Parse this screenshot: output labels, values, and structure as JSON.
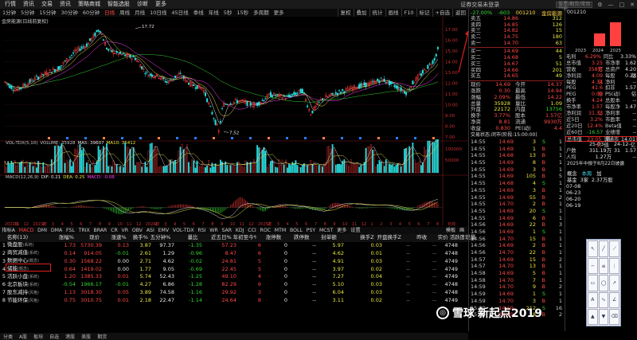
{
  "menu": {
    "items": [
      "行情",
      "资讯",
      "交易",
      "资讯",
      "策略商城",
      "智能选股",
      "诊断",
      "更多"
    ],
    "title": "证券交易未登录",
    "search_placeholder": "股票/期货/常用功能"
  },
  "timeframes": {
    "items": [
      "1分钟",
      "5分钟",
      "15分钟",
      "30分钟",
      "60分钟",
      "日线",
      "周线",
      "月线",
      "10日线",
      "45日线",
      "季线",
      "年线",
      "5秒",
      "15秒",
      "多周期",
      "更多"
    ],
    "active": 5,
    "right": [
      "复权",
      "叠加",
      "统计",
      "画线",
      "F10",
      "标记",
      "+自选",
      "返回"
    ]
  },
  "stock_title": "金房能源(日线前复权)",
  "price_labels": {
    "max": "17.72",
    "min": "7.52",
    "y_axis": [
      "17.00",
      "16.00",
      "15.00",
      "14.00",
      "13.00",
      "12.00",
      "11.00",
      "10.00",
      "9.00",
      "8.00",
      "7.00"
    ]
  },
  "vol_label": {
    "name": "VOL-TDX(5,10)",
    "volume": "VOLUME: 35928",
    "ma5": "MA5: 39607",
    "ma10": "MA10: 35412"
  },
  "vol_axis": [
    "100000",
    "50000"
  ],
  "macd_label": {
    "name": "MACD(12,26,9)",
    "dif": "DIF: 0.21",
    "dea": "DEA: 0.25",
    "macd": "MACD: -0.08"
  },
  "x_axis": [
    "2022年",
    "11",
    "12",
    "2023年",
    "2",
    "3",
    "4",
    "5",
    "6",
    "7",
    "8",
    "9",
    "10",
    "11",
    "12",
    "2024年",
    "2",
    "3",
    "4",
    "5",
    "6",
    "7",
    "8",
    "9",
    "10",
    "11",
    "12",
    "2025年",
    "2",
    "3",
    "4",
    "5",
    "6",
    "7",
    "8",
    "9",
    "10",
    "11",
    "12",
    "1",
    "2",
    "3",
    "4",
    "5",
    "6",
    "7",
    "8",
    "日线"
  ],
  "indicator_bar": {
    "items": [
      "指标A",
      "MACD",
      "DMI",
      "DMA",
      "FSL",
      "TRIX",
      "BRAR",
      "CR",
      "VR",
      "OBV",
      "ASI",
      "EMV",
      "VOL-TDX",
      "RSI",
      "WR",
      "SAR",
      "KDJ",
      "CCI",
      "ROC",
      "MTM",
      "BOLL",
      "PSY",
      "MCST",
      "更多",
      "设置"
    ],
    "active": 1,
    "right": [
      "模板",
      "画"
    ]
  },
  "table": {
    "headers": [
      "",
      "名称(13)",
      "涨幅%",
      "现价",
      "涨速%",
      "换手%",
      "五分钟%",
      "量比",
      "近五日%",
      "年初至今%",
      "涨停数",
      "跌停数",
      "封单额",
      "换手Z",
      "开盘换手Z",
      "昨收",
      "实价",
      "活跃度",
      "现量"
    ],
    "rows": [
      [
        "1",
        "微盘股",
        "1.73",
        "5730.39",
        "0.13",
        "3.87",
        "97.37",
        "-1.35",
        "57.23",
        "6",
        "0",
        "--",
        "5.97",
        "0.03",
        "--",
        "--",
        "4748",
        "",
        ""
      ],
      [
        "2",
        "商贸减值",
        "0.14",
        "914.05",
        "-0.01",
        "2.61",
        "1.29",
        "-0.96",
        "8.47",
        "6",
        "0",
        "--",
        "4.62",
        "0.01",
        "--",
        "--",
        "4748",
        "",
        ""
      ],
      [
        "3",
        "数据中心",
        "0.30",
        "1568.22",
        "0.00",
        "2.71",
        "4.62",
        "-0.02",
        "24.81",
        "5",
        "0",
        "--",
        "4.91",
        "0.03",
        "--",
        "--",
        "4749",
        "",
        ""
      ],
      [
        "4",
        "储能",
        "0.64",
        "1419.02",
        "0.00",
        "1.77",
        "9.05",
        "-0.69",
        "22.45",
        "5",
        "0",
        "--",
        "3.97",
        "0.02",
        "--",
        "--",
        "4749",
        "",
        ""
      ],
      [
        "5",
        "活跃小盘",
        "1.20",
        "1385.33",
        "0.01",
        "5.74",
        "52.43",
        "-1.25",
        "49.10",
        "4",
        "0",
        "--",
        "7.27",
        "0.04",
        "--",
        "--",
        "4749",
        "",
        ""
      ],
      [
        "6",
        "北京板块",
        "-0.54",
        "1966.17",
        "-0.01",
        "4.27",
        "6.86",
        "-1.28",
        "82.29",
        "6",
        "0",
        "--",
        "5.10",
        "0.03",
        "--",
        "--",
        "4748",
        "",
        ""
      ],
      [
        "7",
        "股东减持",
        "1.13",
        "3018.30",
        "0.05",
        "3.89",
        "74.58",
        "-1.16",
        "29.92",
        "3",
        "0",
        "--",
        "6.04",
        "0.03",
        "--",
        "--",
        "4748",
        "",
        ""
      ],
      [
        "8",
        "节能环保",
        "0.75",
        "3010.75",
        "0.01",
        "2.18",
        "22.47",
        "-1.14",
        "24.64",
        "8",
        "0",
        "--",
        "3.11",
        "0.02",
        "--",
        "--",
        "4749",
        "",
        ""
      ]
    ],
    "suffixes": [
      "(系统)",
      "(系统)",
      "(概念)",
      "(概念)",
      "(系统)",
      "(系统)",
      "(风格)",
      "(风格)"
    ]
  },
  "bottom_bar": [
    "分类",
    "A股",
    "板块",
    "自选",
    "港股",
    "美股",
    "期货"
  ],
  "quote": {
    "code": "001210",
    "name": "金房能源",
    "change": "-27.00%",
    "change2": "-603",
    "asks": [
      [
        "卖五",
        "14.86",
        "312"
      ],
      [
        "卖四",
        "14.85",
        "126"
      ],
      [
        "卖三",
        "14.82",
        "15"
      ],
      [
        "卖二",
        "14.75",
        "180"
      ],
      [
        "卖一",
        "14.70",
        "63"
      ]
    ],
    "bids": [
      [
        "买一",
        "14.69",
        "44"
      ],
      [
        "买二",
        "14.68",
        "5"
      ],
      [
        "买三",
        "14.67",
        "51"
      ],
      [
        "买四",
        "14.66",
        "201"
      ],
      [
        "买五",
        "14.65",
        "49"
      ]
    ],
    "stats": [
      [
        "现价",
        "14.69",
        "今开",
        "14.37"
      ],
      [
        "涨跌",
        "0.30",
        "最高",
        "14.94"
      ],
      [
        "涨幅",
        "2.09%",
        "最低",
        "14.22"
      ],
      [
        "总量",
        "35928",
        "量比",
        "1.09"
      ],
      [
        "外盘",
        "22172",
        "内盘",
        "13756"
      ],
      [
        "换手",
        "3.77%",
        "股本",
        "1.57亿"
      ],
      [
        "净资",
        "8.81",
        "流通",
        "9930万"
      ],
      [
        "收益",
        "0.830",
        "PE(动)",
        "4.4"
      ]
    ],
    "ticks_title": "交易状态:闭市(阶段:15:00:00)",
    "ticks": [
      [
        "14:55",
        "14.69",
        "3",
        "S",
        "1"
      ],
      [
        "14:55",
        "14.69",
        "1",
        "B",
        "1"
      ],
      [
        "14:55",
        "14.68",
        "13",
        "B",
        "1"
      ],
      [
        "14:55",
        "14.69",
        "8",
        "B",
        "1"
      ],
      [
        "14:55",
        "14.69",
        "3",
        "B",
        "1"
      ],
      [
        "14:55",
        "14.69",
        "105",
        "B",
        "5"
      ],
      [
        "14:55",
        "14.68",
        "4",
        "S",
        "1"
      ],
      [
        "14:55",
        "14.69",
        "3",
        "B",
        "1"
      ],
      [
        "14:55",
        "14.69",
        "55",
        "B",
        "2"
      ],
      [
        "14:55",
        "14.70",
        "2",
        "B",
        "1"
      ],
      [
        "14:55",
        "14.69",
        "20",
        "S",
        "1"
      ],
      [
        "14:55",
        "14.69",
        "6",
        "B",
        "1"
      ],
      [
        "14:56",
        "14.69",
        "22",
        "B",
        "3"
      ],
      [
        "14:56",
        "14.69",
        "1",
        "S",
        "1"
      ],
      [
        "14:56",
        "14.70",
        "15",
        "B",
        "1"
      ],
      [
        "14:56",
        "14.69",
        "2",
        "B",
        "1"
      ],
      [
        "14:56",
        "14.70",
        "22",
        "B",
        "1"
      ],
      [
        "14:57",
        "14.69",
        "15",
        "B",
        "2"
      ],
      [
        "14:57",
        "14.70",
        "13",
        "B",
        "1"
      ],
      [
        "14:58",
        "14.69",
        "5",
        "B",
        "1"
      ],
      [
        "14:58",
        "14.70",
        "7",
        "B",
        "1"
      ],
      [
        "14:59",
        "14.70",
        "9",
        "B",
        "2"
      ],
      [
        "14:59",
        "14.69",
        "1",
        "S",
        "1"
      ],
      [
        "14:59",
        "14.70",
        "3",
        "B",
        "1"
      ],
      [
        "15:00",
        "14.69",
        "212",
        "S",
        "16"
      ],
      [
        "15:00",
        "14.69",
        "8",
        "B",
        "2"
      ]
    ]
  },
  "fin": {
    "code": "001210",
    "bars_years": [
      "2023",
      "2024",
      "2025"
    ],
    "rows": [
      [
        "毛利",
        "6.29%",
        "同比",
        "3.33%"
      ],
      [
        "总市值",
        "3.25亿",
        "市净率",
        "1.62"
      ],
      [
        "营收",
        "358万",
        "总资产",
        "4.20亿"
      ],
      [
        "净利润",
        "4.09亿",
        "每股",
        "0.28"
      ],
      [
        "每股",
        "4.34",
        "净利",
        "--"
      ],
      [
        "PEG",
        "41.6倍",
        "扣非",
        "1.57亿"
      ],
      [
        "PEG",
        "0.00",
        "PS(动)",
        "--"
      ],
      [
        "换手",
        "4.24",
        "总股本",
        "--"
      ],
      [
        "市净率",
        "1.57亿",
        "每股净",
        "1.47"
      ],
      [
        "净利润",
        "31.33",
        "净利率",
        "--"
      ],
      [
        "近5日",
        "3.2%",
        "市盈率",
        "--"
      ],
      [
        "近20日",
        "12.4%",
        "Beta值",
        "--"
      ],
      [
        "近60日",
        "-16.57",
        "业绩增速",
        "--"
      ],
      [
        "总市值",
        "23.05亿",
        "流通市值",
        "14.01亿"
      ]
    ],
    "dates": [
      "25-03-31",
      "24-12-31"
    ],
    "d_rows": [
      [
        "户数",
        "1.19万",
        "1.57"
      ],
      [
        "人均",
        "1.27万",
        "--"
      ]
    ],
    "notes": [
      "2025年中报于8月22日披露"
    ],
    "tabs": [
      "概念",
      "本周",
      "加"
    ],
    "base": [
      "基金",
      "3家",
      "2.37万股"
    ],
    "events": [
      "07-08",
      "06-23",
      "06-20",
      "06-19"
    ]
  },
  "watermark": {
    "brand": "雪球",
    "author": "新起点2019"
  },
  "colors": {
    "up": "#ff4848",
    "down": "#33d633",
    "bg": "#000000",
    "accent": "#e02020",
    "ma5": "#e6e6e6",
    "ma10": "#e8e840"
  }
}
